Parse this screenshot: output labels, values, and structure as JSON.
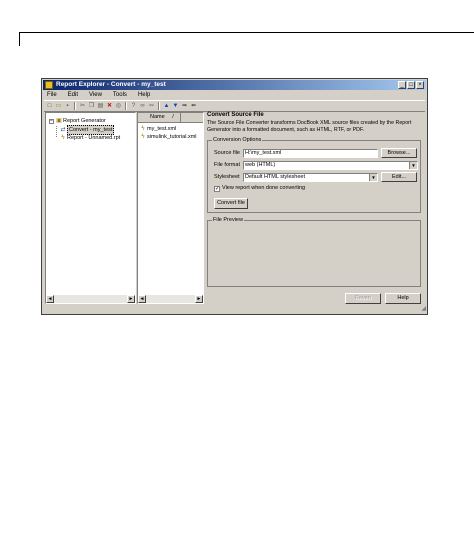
{
  "window": {
    "title": "Report Explorer - Convert - my_test",
    "controls": {
      "minimize": "_",
      "maximize": "□",
      "close": "×"
    }
  },
  "menu": [
    "File",
    "Edit",
    "View",
    "Tools",
    "Help"
  ],
  "toolbar": {
    "icons": [
      "new-icon",
      "open-icon",
      "save-icon",
      "cut-icon",
      "copy-icon",
      "paste-icon",
      "delete-icon",
      "find-icon",
      "help-cursor-icon",
      "link-icon",
      "link2-icon",
      "move-up-icon",
      "move-down-icon",
      "move-right-icon",
      "move-left-icon"
    ]
  },
  "tree": {
    "root": "Report Generator",
    "root_expander": "−",
    "children": [
      "Convert - my_test",
      "Report - Unnamed.rpt"
    ]
  },
  "files": {
    "column_header": "Name",
    "sort_indicator": "/",
    "items": [
      "my_test.xml",
      "simulink_tutorial.xml"
    ]
  },
  "convert": {
    "section_title": "Convert Source File",
    "description": "The Source File Converter transforms DocBook XML source files created by the Report Generator into a formatted document, such as HTML, RTF, or PDF.",
    "options_legend": "Conversion Options",
    "source_file_label": "Source file",
    "source_file_value": "H:\\my_test.xml",
    "browse_label": "Browse...",
    "file_format_label": "File format",
    "file_format_value": "web (HTML)",
    "stylesheet_label": "Stylesheet",
    "stylesheet_value": "Default HTML stylesheet",
    "edit_label": "Edit...",
    "view_report_label": "View report when done converting",
    "view_report_checked": "✓",
    "convert_button": "Convert file",
    "preview_legend": "File Preview"
  },
  "footer": {
    "revert_label": "Revert",
    "help_label": "Help"
  },
  "scroll": {
    "left": "◄",
    "right": "►"
  }
}
